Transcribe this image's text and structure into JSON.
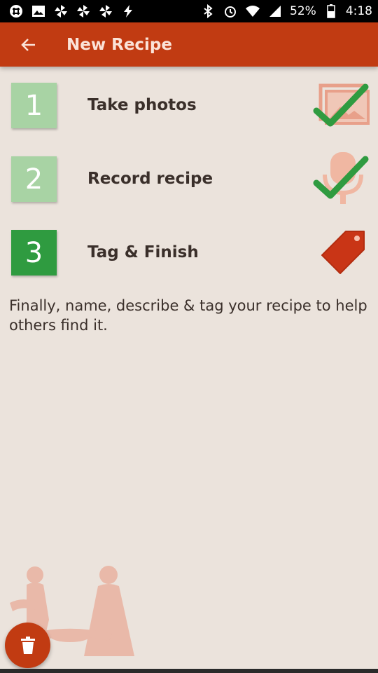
{
  "status_bar": {
    "battery": "52%",
    "time": "4:18",
    "left_icons": [
      "slack-icon",
      "gallery-icon",
      "pinwheel-icon",
      "pinwheel-icon",
      "pinwheel-icon",
      "bolt-icon"
    ],
    "right_icons": [
      "bluetooth-icon",
      "alarm-icon",
      "wifi-icon",
      "signal-icon",
      "battery-icon"
    ]
  },
  "app_bar": {
    "title": "New Recipe",
    "back_icon": "arrow-left-icon",
    "color": "#c13b12"
  },
  "steps": [
    {
      "number": "1",
      "label": "Take photos",
      "state": "done",
      "icon": "photos-check-icon"
    },
    {
      "number": "2",
      "label": "Record recipe",
      "state": "done",
      "icon": "microphone-check-icon"
    },
    {
      "number": "3",
      "label": "Tag & Finish",
      "state": "active",
      "icon": "tag-icon"
    }
  ],
  "hint": "Finally, name, describe & tag your recipe to help others find it.",
  "fab": {
    "icon": "trash-icon",
    "color": "#c13b12"
  },
  "colors": {
    "done_step": "#a8d3a4",
    "active_step": "#2f9b40",
    "check": "#2f9b40",
    "background": "#ebe3dc"
  }
}
